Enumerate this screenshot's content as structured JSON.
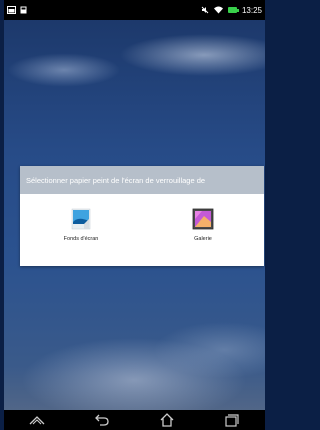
{
  "status_bar": {
    "time": "13:25",
    "icons": [
      "image-notification-icon",
      "screenshot-icon",
      "mute-icon",
      "wifi-icon",
      "battery-icon"
    ]
  },
  "dialog": {
    "title": "Sélectionner papier peint de l'écran de verrouillage de",
    "options": [
      {
        "label": "Fonds d'écran",
        "icon": "wallpaper-icon"
      },
      {
        "label": "Galerie",
        "icon": "gallery-icon"
      }
    ]
  },
  "nav_bar": {
    "buttons": [
      "app-switch-up-icon",
      "back-icon",
      "home-icon",
      "recent-apps-icon"
    ]
  },
  "colors": {
    "dialog_header": "#b6bfca",
    "status_bar": "#000000",
    "battery": "#39d14b"
  }
}
